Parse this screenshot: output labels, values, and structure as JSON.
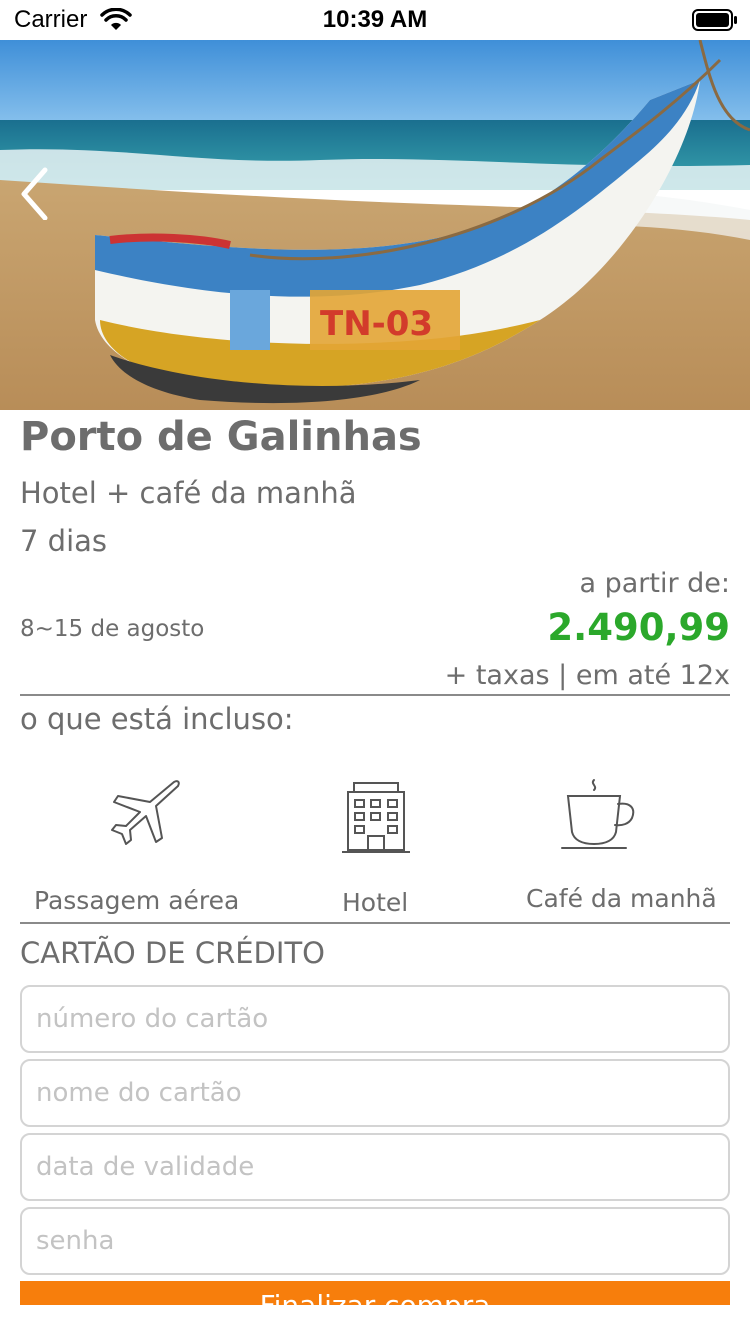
{
  "status_bar": {
    "carrier": "Carrier",
    "time": "10:39 AM"
  },
  "package": {
    "title": "Porto de Galinhas",
    "subtitle": "Hotel + café da manhã",
    "duration": "7 dias",
    "from_label": "a partir de:",
    "dates": "8~15 de agosto",
    "price": "2.490,99",
    "taxes": "+ taxas | em até 12x"
  },
  "included": {
    "label": "o que está incluso:",
    "items": [
      {
        "icon": "airplane-icon",
        "label": "Passagem aérea"
      },
      {
        "icon": "hotel-icon",
        "label": "Hotel"
      },
      {
        "icon": "coffee-cup-icon",
        "label": "Café da manhã"
      }
    ]
  },
  "credit_card": {
    "label": "CARTÃO DE CRÉDITO",
    "fields": [
      {
        "placeholder": "número do cartão",
        "value": ""
      },
      {
        "placeholder": "nome do cartão",
        "value": ""
      },
      {
        "placeholder": "data de validade",
        "value": ""
      },
      {
        "placeholder": "senha",
        "value": ""
      }
    ],
    "submit_label": "Finalizar compra"
  },
  "colors": {
    "price": "#2ba82b",
    "button": "#f77e0c"
  }
}
